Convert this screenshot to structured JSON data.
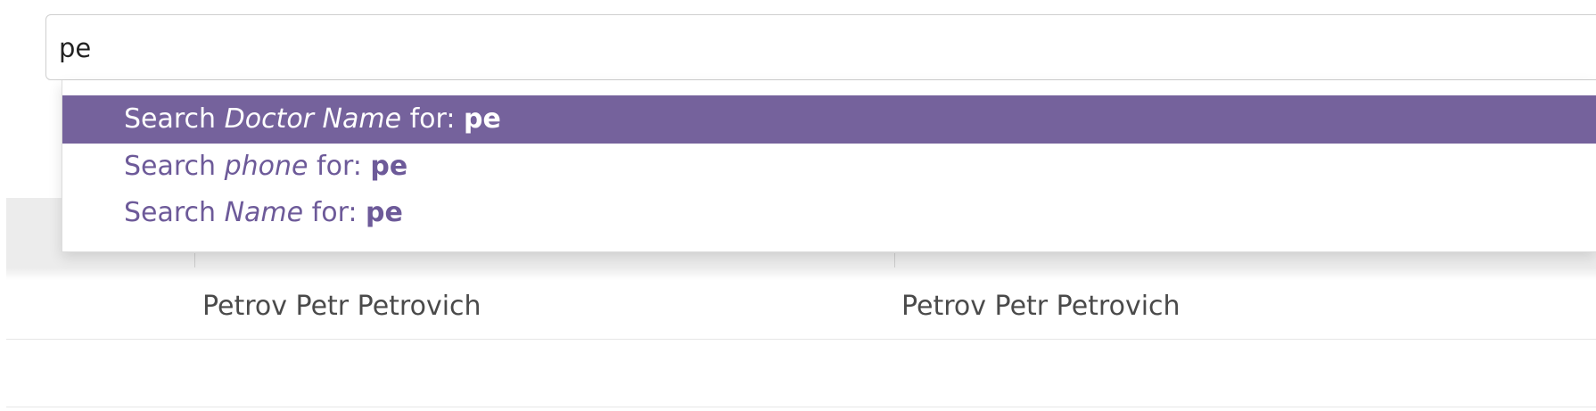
{
  "search": {
    "value": "pe"
  },
  "autocomplete": {
    "items": [
      {
        "prefix": "Search ",
        "field": "Doctor Name",
        "middle": " for: ",
        "query": "pe",
        "active": true
      },
      {
        "prefix": "Search ",
        "field": "phone",
        "middle": " for: ",
        "query": "pe",
        "active": false
      },
      {
        "prefix": "Search ",
        "field": "Name",
        "middle": " for: ",
        "query": "pe",
        "active": false
      }
    ]
  },
  "table": {
    "rows": [
      {
        "cells": [
          "Petrov Petr Petrovich",
          "Petrov Petr Petrovich"
        ]
      },
      {
        "cells": [
          "",
          ""
        ]
      }
    ]
  },
  "colors": {
    "accent": "#75629c",
    "accent_text": "#6d5a99"
  }
}
